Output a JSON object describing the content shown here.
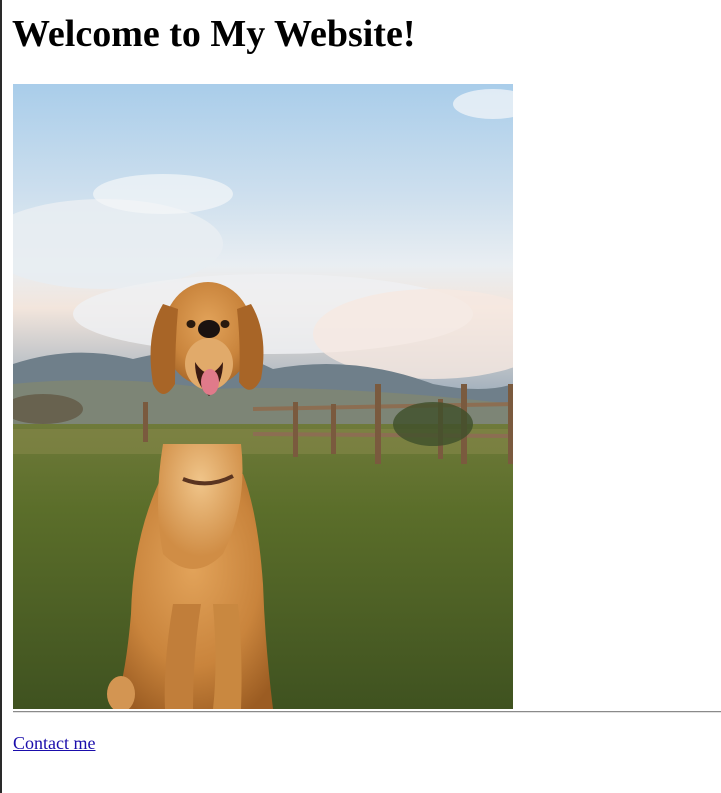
{
  "page": {
    "heading": "Welcome to My Website!"
  },
  "hero_image": {
    "subject": "golden retriever sitting on grass in a field",
    "icon": "dog-photo"
  },
  "footer": {
    "link_label": "Contact me"
  },
  "colors": {
    "link": "#1a0dab",
    "divider": "#8a8a8a",
    "text": "#000000",
    "background": "#ffffff"
  }
}
